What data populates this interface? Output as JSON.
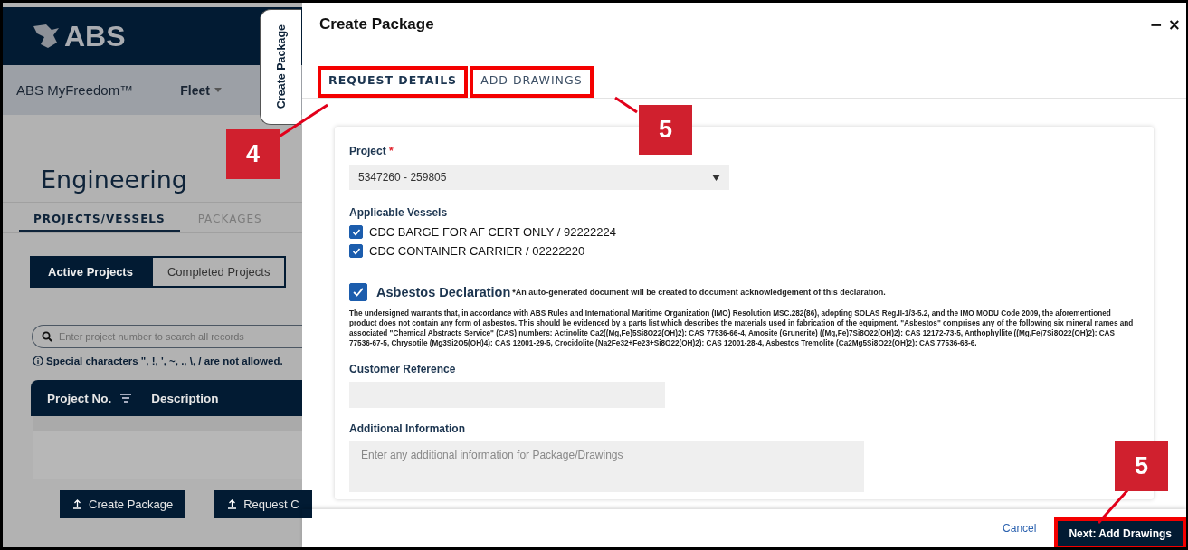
{
  "background": {
    "logo": "ABS",
    "app_name": "ABS MyFreedom™",
    "nav": [
      {
        "label": "Fleet"
      }
    ],
    "heading": "Engineering",
    "tabs": [
      {
        "label": "PROJECTS/VESSELS",
        "selected": true
      },
      {
        "label": "PACKAGES",
        "selected": false
      }
    ],
    "toggle": [
      {
        "label": "Active Projects",
        "selected": true
      },
      {
        "label": "Completed Projects",
        "selected": false
      }
    ],
    "search": {
      "placeholder": "Enter project number to search all records"
    },
    "note": "Special characters \", !, ', ~, ., \\, / are not allowed.",
    "table": {
      "columns": [
        "Project No.",
        "Description"
      ]
    },
    "buttons": [
      "Create Package",
      "Request C"
    ]
  },
  "side_tab": "Create Package",
  "dialog": {
    "title": "Create Package",
    "minimize": "−",
    "close": "×",
    "tabs": [
      {
        "label": "REQUEST DETAILS",
        "selected": true,
        "highlighted": true
      },
      {
        "label": "ADD DRAWINGS",
        "selected": false,
        "highlighted": true
      }
    ],
    "form": {
      "project_label": "Project",
      "required_mark": "*",
      "project_value": "5347260 - 259805",
      "vessels_label": "Applicable Vessels",
      "vessels": [
        {
          "label": "CDC BARGE FOR AF CERT ONLY / 92222224",
          "checked": true
        },
        {
          "label": "CDC CONTAINER CARRIER / 02222220",
          "checked": true
        }
      ],
      "declaration": {
        "checked": true,
        "title": "Asbestos Declaration",
        "note": "*An auto-generated document will be created to document acknowledgement of this declaration.",
        "body": "The undersigned warrants that, in accordance with ABS Rules and International Maritime Organization (IMO) Resolution MSC.282(86), adopting SOLAS Reg.II-1/3-5.2, and the IMO MODU Code 2009, the aforementioned product does not contain any form of asbestos. This should be evidenced by a parts list which describes the materials used in fabrication of the equipment. \"Asbestos\" comprises any of the following six mineral names and associated \"Chemical Abstracts Service\" (CAS) numbers: Actinolite Ca2((Mg,Fe)5Si8O22(OH)2): CAS 77536-66-4, Amosite (Grunerite) ((Mg,Fe)7Si8O22(OH)2): CAS 12172-73-5, Anthophyllite ((Mg,Fe)7Si8O22(OH)2): CAS 77536-67-5, Chrysotile (Mg3Si2O5(OH)4): CAS 12001-29-5, Crocidolite (Na2Fe32+Fe23+Si8O22(OH)2): CAS 12001-28-4, Asbestos Tremolite (Ca2Mg5Si8O22(OH)2): CAS 77536-68-6."
      },
      "customer_reference_label": "Customer Reference",
      "additional_info_label": "Additional Information",
      "additional_info_placeholder": "Enter any additional information for Package/Drawings"
    },
    "cancel": "Cancel",
    "next": {
      "label": "Next: Add Drawings",
      "highlighted": true
    }
  },
  "callouts": [
    {
      "label": "4"
    },
    {
      "label": "5"
    },
    {
      "label": "5"
    }
  ]
}
